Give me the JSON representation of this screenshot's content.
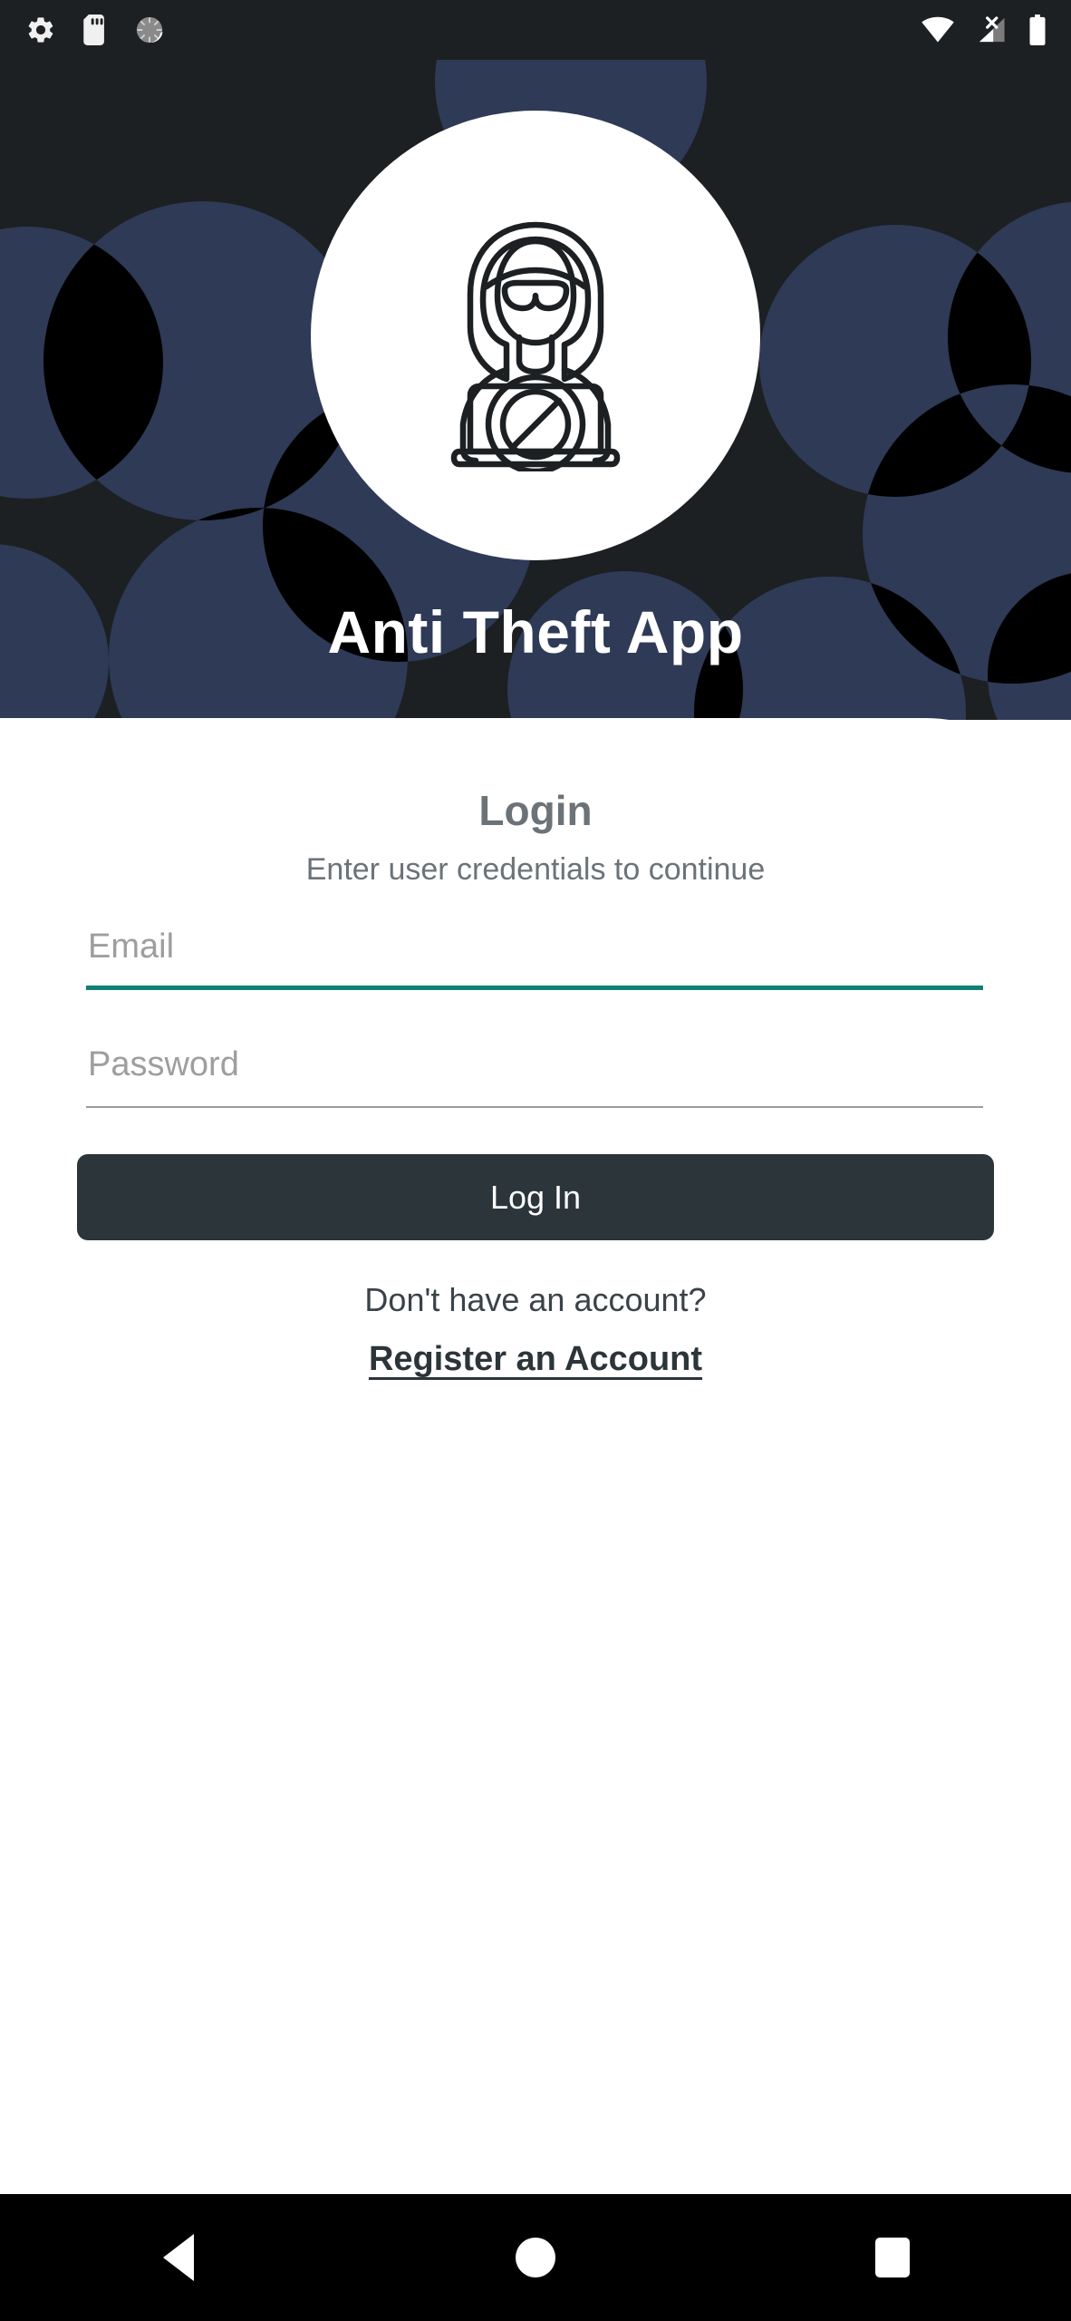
{
  "status_bar": {
    "left_icons": [
      {
        "name": "settings-gear-icon",
        "label": "Settings"
      },
      {
        "name": "sd-card-icon",
        "label": "SD card"
      },
      {
        "name": "sync-spinner-icon",
        "label": "Syncing"
      }
    ],
    "right_icons": [
      {
        "name": "wifi-icon",
        "label": "Wi-Fi full signal"
      },
      {
        "name": "cellular-no-sim-icon",
        "label": "No SIM"
      },
      {
        "name": "battery-full-icon",
        "label": "Battery full"
      }
    ]
  },
  "header": {
    "app_title": "Anti Theft App",
    "logo_icon": "hacker-laptop-blocked-icon",
    "background_color": "#1C2022",
    "pattern_color": "#2E3A56",
    "logo_background": "#FFFFFF"
  },
  "login": {
    "heading": "Login",
    "subheading": "Enter user credentials to continue",
    "email": {
      "placeholder": "Email",
      "value": "",
      "focused": true,
      "underline_color": "#0E8174"
    },
    "password": {
      "placeholder": "Password",
      "value": "",
      "focused": false,
      "underline_color": "#9B9B9B"
    },
    "submit_label": "Log In",
    "submit_color": "#2C3539",
    "no_account_text": "Don't have an account?",
    "register_link": "Register an Account"
  },
  "nav_bar": {
    "back": "back-button",
    "home": "home-button",
    "recents": "recents-button",
    "background": "#000000"
  }
}
